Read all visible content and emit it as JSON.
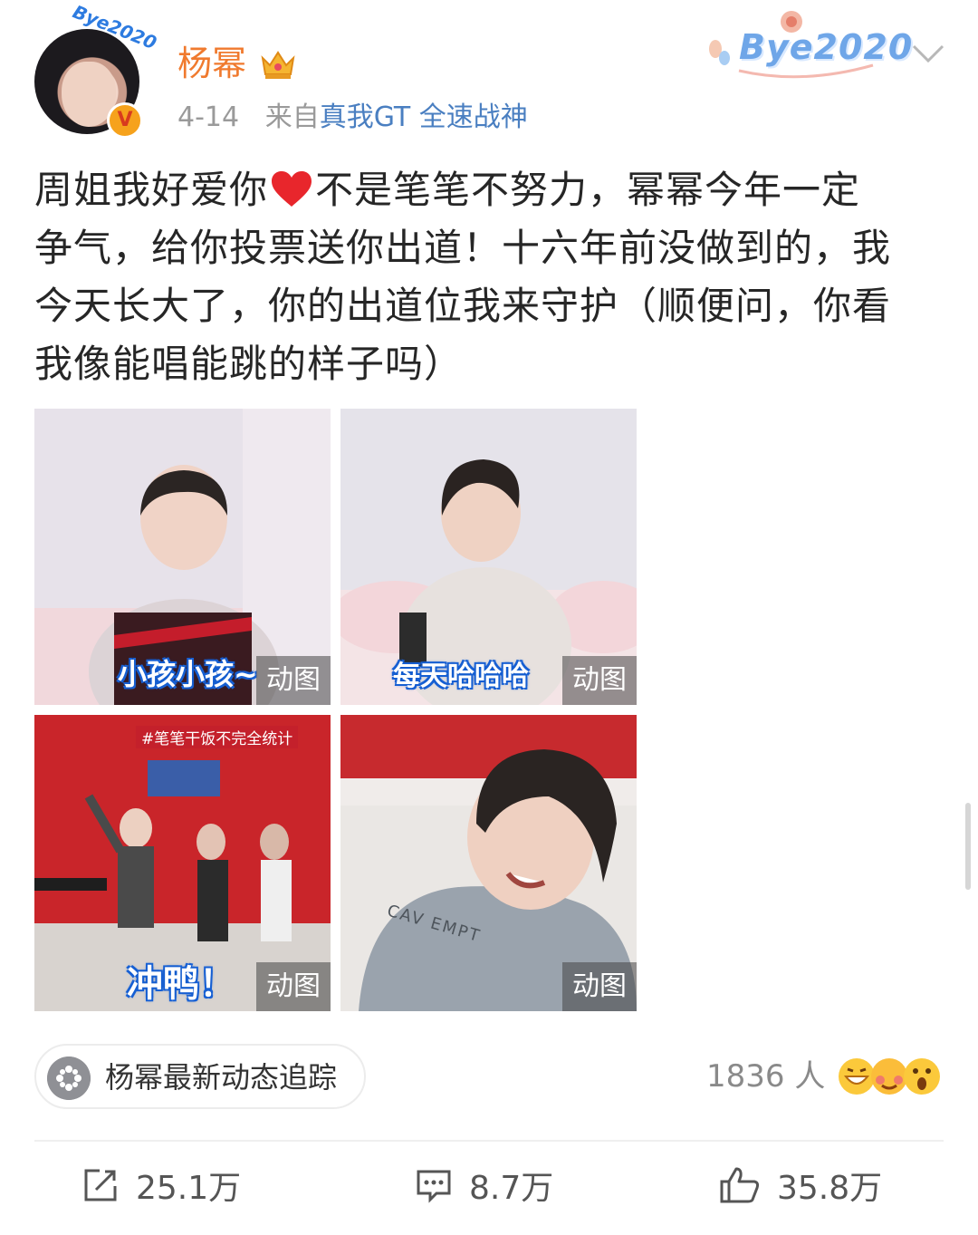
{
  "header": {
    "username": "杨幂",
    "date": "4-14",
    "source_prefix": "来自",
    "source_device": "真我GT 全速战神",
    "avatar_frame_text": "Bye2020",
    "decoration_text": "Bye2020",
    "verified_glyph": "V"
  },
  "post": {
    "lines": [
      [
        "周姐我好爱你",
        "不是笔笔不努力，幂幂今年一定"
      ],
      [
        "争气，给你投票送你出道！十六年前没做到的，我"
      ],
      [
        "今天长大了，你的出道位我来守护（顺便问，你看"
      ],
      [
        "我像能唱能跳的样子吗）"
      ]
    ],
    "heart_icon": "heart-icon"
  },
  "images": [
    {
      "caption": "小孩小孩~",
      "badge": "动图"
    },
    {
      "caption": "每天哈哈哈",
      "badge": "动图"
    },
    {
      "caption": "冲鸭！",
      "badge": "动图",
      "overlay_tag": "#笔笔干饭不完全统计"
    },
    {
      "caption": "",
      "badge": "动图",
      "shirt_text": "CAV EMPT"
    }
  ],
  "topic": {
    "label": "杨幂最新动态追踪",
    "icon": "topic-icon"
  },
  "reactions": {
    "count_text": "1836 人",
    "emojis": [
      "grin-emoji",
      "blush-emoji",
      "surprised-emoji"
    ]
  },
  "actions": {
    "repost": "25.1万",
    "comment": "8.7万",
    "like": "35.8万"
  },
  "colors": {
    "username": "#f07a2e",
    "source_link": "#4a7fc1",
    "meta_gray": "#9a9a9a"
  }
}
